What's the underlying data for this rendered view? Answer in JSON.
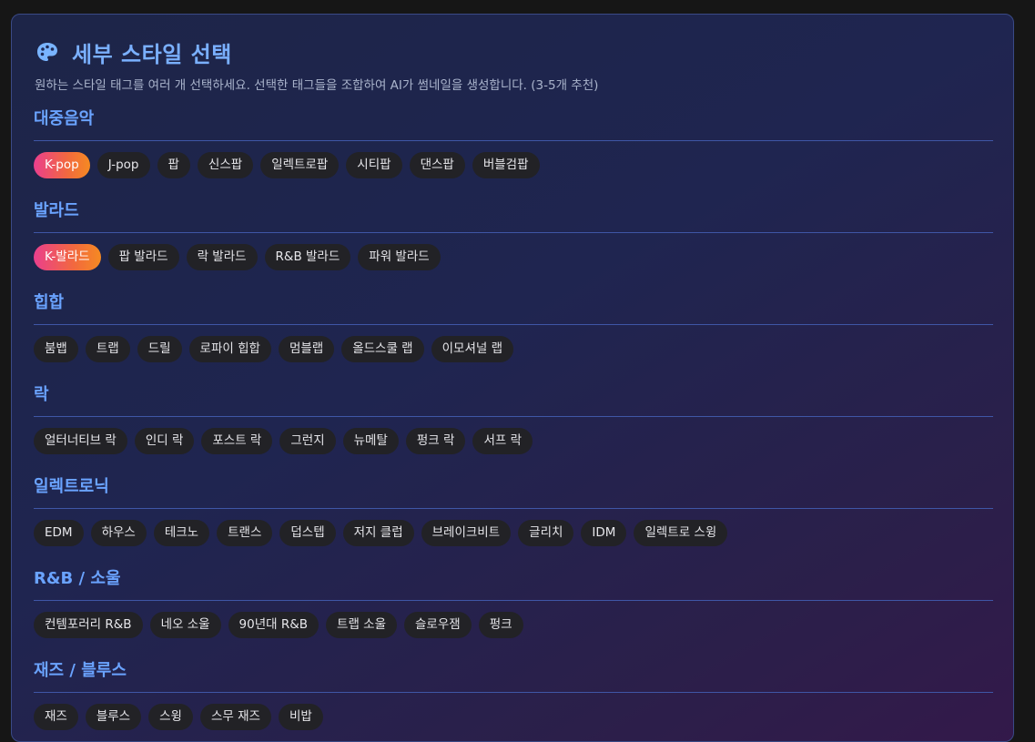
{
  "header": {
    "title": "세부 스타일 선택",
    "subtitle": "원하는 스타일 태그를 여러 개 선택하세요. 선택한 태그들을 조합하여 AI가 썸네일을 생성합니다. (3-5개 추천)",
    "icon": "palette-icon"
  },
  "colors": {
    "accent": "#6aa3ff",
    "selected_start": "#ea3f8d",
    "selected_end": "#f58a22",
    "chip_bg": "#222226"
  },
  "categories": [
    {
      "name": "대중음악",
      "tags": [
        {
          "label": "K-pop",
          "selected": true
        },
        {
          "label": "J-pop",
          "selected": false
        },
        {
          "label": "팝",
          "selected": false
        },
        {
          "label": "신스팝",
          "selected": false
        },
        {
          "label": "일렉트로팝",
          "selected": false
        },
        {
          "label": "시티팝",
          "selected": false
        },
        {
          "label": "댄스팝",
          "selected": false
        },
        {
          "label": "버블검팝",
          "selected": false
        }
      ]
    },
    {
      "name": "발라드",
      "tags": [
        {
          "label": "K-발라드",
          "selected": true
        },
        {
          "label": "팝 발라드",
          "selected": false
        },
        {
          "label": "락 발라드",
          "selected": false
        },
        {
          "label": "R&B 발라드",
          "selected": false
        },
        {
          "label": "파워 발라드",
          "selected": false
        }
      ]
    },
    {
      "name": "힙합",
      "tags": [
        {
          "label": "붐뱁",
          "selected": false
        },
        {
          "label": "트랩",
          "selected": false
        },
        {
          "label": "드릴",
          "selected": false
        },
        {
          "label": "로파이 힙합",
          "selected": false
        },
        {
          "label": "멈블랩",
          "selected": false
        },
        {
          "label": "올드스쿨 랩",
          "selected": false
        },
        {
          "label": "이모셔널 랩",
          "selected": false
        }
      ]
    },
    {
      "name": "락",
      "tags": [
        {
          "label": "얼터너티브 락",
          "selected": false
        },
        {
          "label": "인디 락",
          "selected": false
        },
        {
          "label": "포스트 락",
          "selected": false
        },
        {
          "label": "그런지",
          "selected": false
        },
        {
          "label": "뉴메탈",
          "selected": false
        },
        {
          "label": "펑크 락",
          "selected": false
        },
        {
          "label": "서프 락",
          "selected": false
        }
      ]
    },
    {
      "name": "일렉트로닉",
      "tags": [
        {
          "label": "EDM",
          "selected": false
        },
        {
          "label": "하우스",
          "selected": false
        },
        {
          "label": "테크노",
          "selected": false
        },
        {
          "label": "트랜스",
          "selected": false
        },
        {
          "label": "덥스텝",
          "selected": false
        },
        {
          "label": "저지 클럽",
          "selected": false
        },
        {
          "label": "브레이크비트",
          "selected": false
        },
        {
          "label": "글리치",
          "selected": false
        },
        {
          "label": "IDM",
          "selected": false
        },
        {
          "label": "일렉트로 스윙",
          "selected": false
        }
      ]
    },
    {
      "name": "R&B / 소울",
      "tags": [
        {
          "label": "컨템포러리 R&B",
          "selected": false
        },
        {
          "label": "네오 소울",
          "selected": false
        },
        {
          "label": "90년대 R&B",
          "selected": false
        },
        {
          "label": "트랩 소울",
          "selected": false
        },
        {
          "label": "슬로우잼",
          "selected": false
        },
        {
          "label": "펑크",
          "selected": false
        }
      ]
    },
    {
      "name": "재즈 / 블루스",
      "tags": [
        {
          "label": "재즈",
          "selected": false
        },
        {
          "label": "블루스",
          "selected": false
        },
        {
          "label": "스윙",
          "selected": false
        },
        {
          "label": "스무 재즈",
          "selected": false
        },
        {
          "label": "비밥",
          "selected": false
        }
      ]
    }
  ]
}
